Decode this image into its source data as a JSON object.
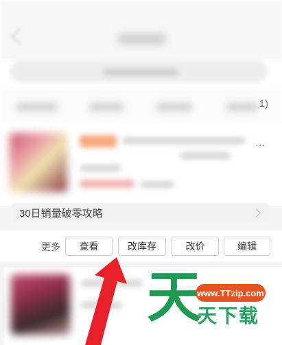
{
  "tabs": {
    "count_suffix": "1)"
  },
  "product": {
    "more_dots": "..."
  },
  "promo": {
    "label": "30日销量破零攻略"
  },
  "actions": {
    "more_label": "更多",
    "view_label": "查看",
    "edit_stock_label": "改库存",
    "edit_price_label": "改价",
    "edit_label": "编辑"
  },
  "watermark": {
    "big_char": "天",
    "url": "www.TTzip.com",
    "chars": "天下载"
  },
  "colors": {
    "watermark_green": "#1f9a54",
    "watermark_orange": "#e65423",
    "arrow_red": "#e8202a"
  }
}
